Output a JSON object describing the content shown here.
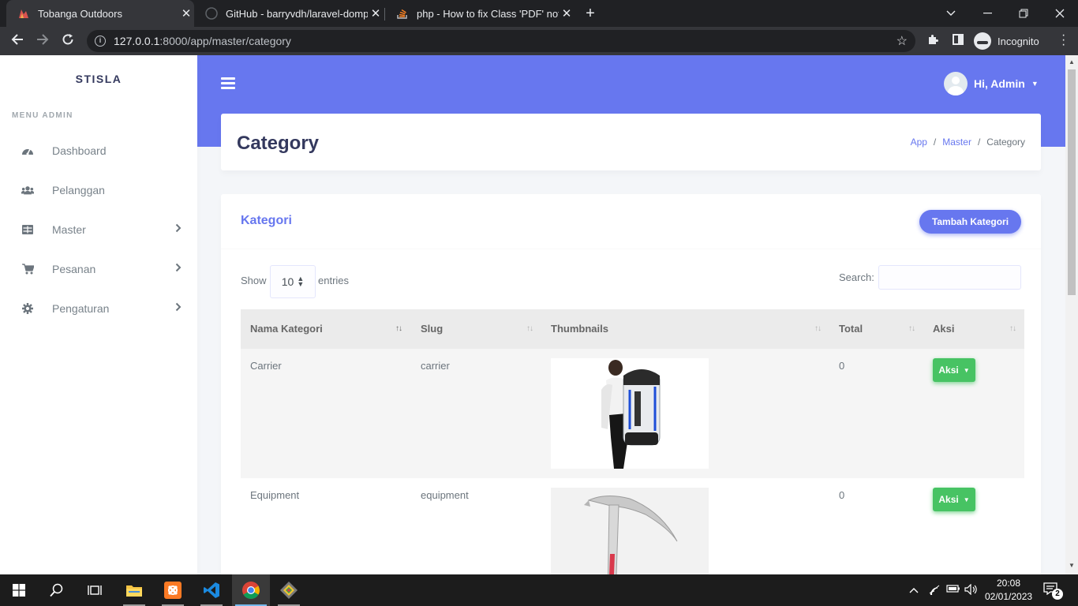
{
  "browser": {
    "tabs": [
      {
        "title": "Tobanga Outdoors",
        "active": true
      },
      {
        "title": "GitHub - barryvdh/laravel-dompd",
        "active": false
      },
      {
        "title": "php - How to fix Class 'PDF' not f",
        "active": false
      }
    ],
    "url_host": "127.0.0.1",
    "url_rest": ":8000/app/master/category",
    "profile_label": "Incognito"
  },
  "sidebar": {
    "brand": "STISLA",
    "menu_header": "MENU ADMIN",
    "items": [
      {
        "label": "Dashboard",
        "icon": "tachometer-icon",
        "has_children": false
      },
      {
        "label": "Pelanggan",
        "icon": "users-icon",
        "has_children": false
      },
      {
        "label": "Master",
        "icon": "table-icon",
        "has_children": true
      },
      {
        "label": "Pesanan",
        "icon": "cart-icon",
        "has_children": true
      },
      {
        "label": "Pengaturan",
        "icon": "gear-icon",
        "has_children": true
      }
    ]
  },
  "navbar": {
    "greeting": "Hi, Admin"
  },
  "section": {
    "title": "Category",
    "breadcrumb": [
      "App",
      "Master",
      "Category"
    ]
  },
  "card": {
    "title": "Kategori",
    "add_button": "Tambah Kategori",
    "show_label": "Show",
    "entries_value": "10",
    "entries_label": "entries",
    "search_label": "Search:"
  },
  "table": {
    "columns": [
      "Nama Kategori",
      "Slug",
      "Thumbnails",
      "Total",
      "Aksi"
    ],
    "sorted_column": "Nama Kategori",
    "rows": [
      {
        "name": "Carrier",
        "slug": "carrier",
        "thumbnail": "backpack-photo",
        "total": "0",
        "action": "Aksi"
      },
      {
        "name": "Equipment",
        "slug": "equipment",
        "thumbnail": "ice-axe-photo",
        "total": "0",
        "action": "Aksi"
      }
    ]
  },
  "taskbar": {
    "time": "20:08",
    "date": "02/01/2023",
    "notification_count": "2"
  },
  "colors": {
    "primary": "#6777ef",
    "success": "#47c363",
    "sidebar_text": "#78828a"
  }
}
